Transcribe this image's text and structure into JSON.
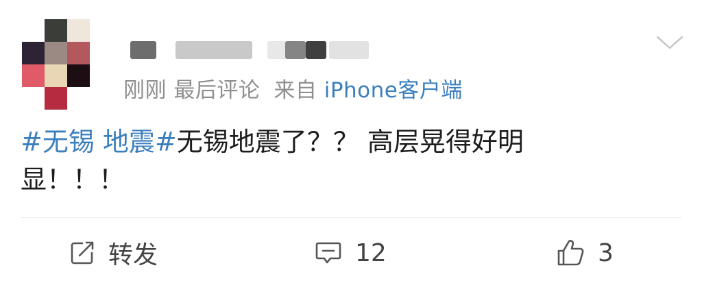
{
  "post": {
    "meta": {
      "time": "刚刚",
      "activity": "最后评论",
      "source_prefix": "来自",
      "source": "iPhone客户端"
    },
    "topic": "#无锡 地震#",
    "text": "无锡地震了？？ 高层晃得好明显！！！"
  },
  "actions": {
    "repost_label": "转发",
    "comment_count": "12",
    "like_count": "3"
  },
  "colors": {
    "link": "#3c7fbd",
    "meta_text": "#8f8f8f",
    "icon": "#555555"
  },
  "icons": {
    "expand": "chevron-down",
    "repost": "share-arrow",
    "comment": "speech-bubble",
    "like": "thumbs-up"
  }
}
